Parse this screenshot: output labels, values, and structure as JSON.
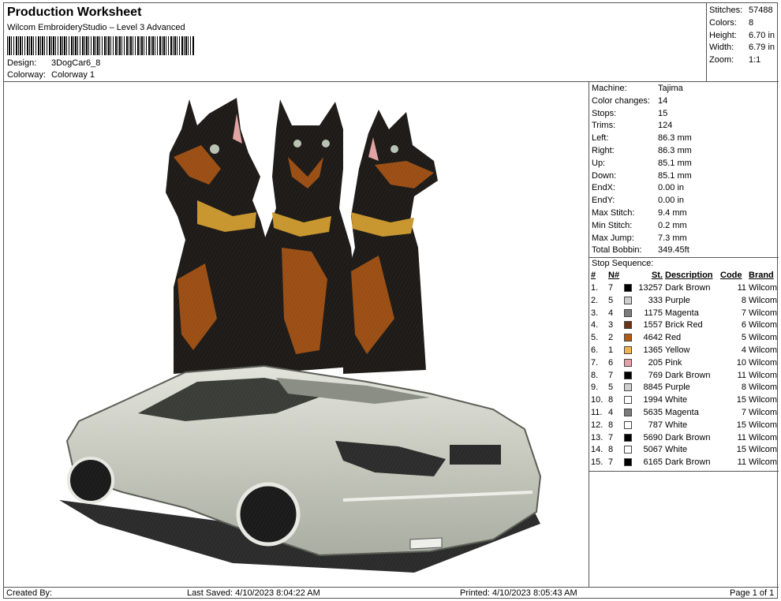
{
  "header": {
    "title": "Production Worksheet",
    "subtitle": "Wilcom EmbroideryStudio – Level 3 Advanced",
    "design_label": "Design:",
    "design_value": "3DogCar6_8",
    "colorway_label": "Colorway:",
    "colorway_value": "Colorway 1"
  },
  "summary": [
    {
      "label": "Stitches:",
      "value": "57488"
    },
    {
      "label": "Colors:",
      "value": "8"
    },
    {
      "label": "Height:",
      "value": "6.70 in"
    },
    {
      "label": "Width:",
      "value": "6.79 in"
    },
    {
      "label": "Zoom:",
      "value": "1:1"
    }
  ],
  "machine_info": [
    {
      "label": "Machine:",
      "value": "Tajima"
    },
    {
      "label": "Color changes:",
      "value": "14"
    },
    {
      "label": "Stops:",
      "value": "15"
    },
    {
      "label": "Trims:",
      "value": "124"
    },
    {
      "label": "Left:",
      "value": "86.3 mm"
    },
    {
      "label": "Right:",
      "value": "86.3 mm"
    },
    {
      "label": "Up:",
      "value": "85.1 mm"
    },
    {
      "label": "Down:",
      "value": "85.1 mm"
    },
    {
      "label": "EndX:",
      "value": "0.00 in"
    },
    {
      "label": "EndY:",
      "value": "0.00 in"
    },
    {
      "label": "Max Stitch:",
      "value": "9.4 mm"
    },
    {
      "label": "Min Stitch:",
      "value": "0.2 mm"
    },
    {
      "label": "Max Jump:",
      "value": "7.3 mm"
    },
    {
      "label": "Total Bobbin:",
      "value": "349.45ft"
    }
  ],
  "stop_sequence": {
    "title": "Stop Sequence:",
    "columns": [
      "#",
      "N#",
      "St.",
      "Description",
      "Code",
      "Brand"
    ],
    "rows": [
      {
        "num": "1.",
        "n": "7",
        "color": "#000000",
        "st": "13257",
        "desc": "Dark Brown",
        "code": "11",
        "brand": "Wilcom"
      },
      {
        "num": "2.",
        "n": "5",
        "color": "#cfcfcf",
        "st": "333",
        "desc": "Purple",
        "code": "8",
        "brand": "Wilcom"
      },
      {
        "num": "3.",
        "n": "4",
        "color": "#7b7b7b",
        "st": "1175",
        "desc": "Magenta",
        "code": "7",
        "brand": "Wilcom"
      },
      {
        "num": "4.",
        "n": "3",
        "color": "#6b3417",
        "st": "1557",
        "desc": "Brick Red",
        "code": "6",
        "brand": "Wilcom"
      },
      {
        "num": "5.",
        "n": "2",
        "color": "#b35a12",
        "st": "4642",
        "desc": "Red",
        "code": "5",
        "brand": "Wilcom"
      },
      {
        "num": "6.",
        "n": "1",
        "color": "#f2b34e",
        "st": "1365",
        "desc": "Yellow",
        "code": "4",
        "brand": "Wilcom"
      },
      {
        "num": "7.",
        "n": "6",
        "color": "#e8a0a8",
        "st": "205",
        "desc": "Pink",
        "code": "10",
        "brand": "Wilcom"
      },
      {
        "num": "8.",
        "n": "7",
        "color": "#000000",
        "st": "769",
        "desc": "Dark Brown",
        "code": "11",
        "brand": "Wilcom"
      },
      {
        "num": "9.",
        "n": "5",
        "color": "#cfcfcf",
        "st": "8845",
        "desc": "Purple",
        "code": "8",
        "brand": "Wilcom"
      },
      {
        "num": "10.",
        "n": "8",
        "color": "#ffffff",
        "st": "1994",
        "desc": "White",
        "code": "15",
        "brand": "Wilcom"
      },
      {
        "num": "11.",
        "n": "4",
        "color": "#7b7b7b",
        "st": "5635",
        "desc": "Magenta",
        "code": "7",
        "brand": "Wilcom"
      },
      {
        "num": "12.",
        "n": "8",
        "color": "#ffffff",
        "st": "787",
        "desc": "White",
        "code": "15",
        "brand": "Wilcom"
      },
      {
        "num": "13.",
        "n": "7",
        "color": "#000000",
        "st": "5690",
        "desc": "Dark Brown",
        "code": "11",
        "brand": "Wilcom"
      },
      {
        "num": "14.",
        "n": "8",
        "color": "#ffffff",
        "st": "5067",
        "desc": "White",
        "code": "15",
        "brand": "Wilcom"
      },
      {
        "num": "15.",
        "n": "7",
        "color": "#000000",
        "st": "6165",
        "desc": "Dark Brown",
        "code": "11",
        "brand": "Wilcom"
      }
    ]
  },
  "footer": {
    "created_by": "Created By:",
    "last_saved": "Last Saved: 4/10/2023 8:04:22 AM",
    "printed": "Printed: 4/10/2023 8:05:43 AM",
    "page": "Page 1 of 1"
  },
  "design_colors": {
    "dog_black": "#1d1a17",
    "dog_tan": "#9a4e14",
    "collar": "#c8962e",
    "car_body": "#c9cbc0",
    "car_shadow": "#2a2a2a"
  }
}
